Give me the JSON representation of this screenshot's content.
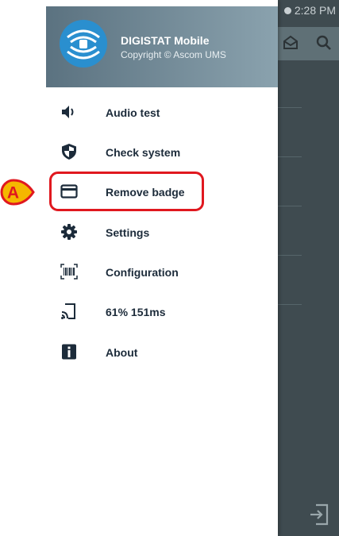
{
  "status_bar": {
    "time": "2:28 PM"
  },
  "drawer": {
    "app_name": "DIGISTAT Mobile",
    "copyright": "Copyright © Ascom UMS"
  },
  "menu": [
    {
      "label": "Audio test",
      "icon": "speaker-icon"
    },
    {
      "label": "Check system",
      "icon": "shield-icon"
    },
    {
      "label": "Remove badge",
      "icon": "card-icon",
      "highlighted": true
    },
    {
      "label": "Settings",
      "icon": "gear-icon"
    },
    {
      "label": "Configuration",
      "icon": "barcode-scan-icon"
    },
    {
      "label": "61% 151ms",
      "icon": "cast-signal-icon"
    },
    {
      "label": "About",
      "icon": "info-icon"
    }
  ],
  "callout": {
    "letter": "A",
    "color": "#f5b700",
    "border_color": "#e0181f"
  },
  "colors": {
    "header_gradient_start": "#5b7280",
    "header_gradient_end": "#8aa2ae",
    "logo": "#2a8fcf",
    "highlight": "#e0181f",
    "label": "#1c2b3a"
  }
}
